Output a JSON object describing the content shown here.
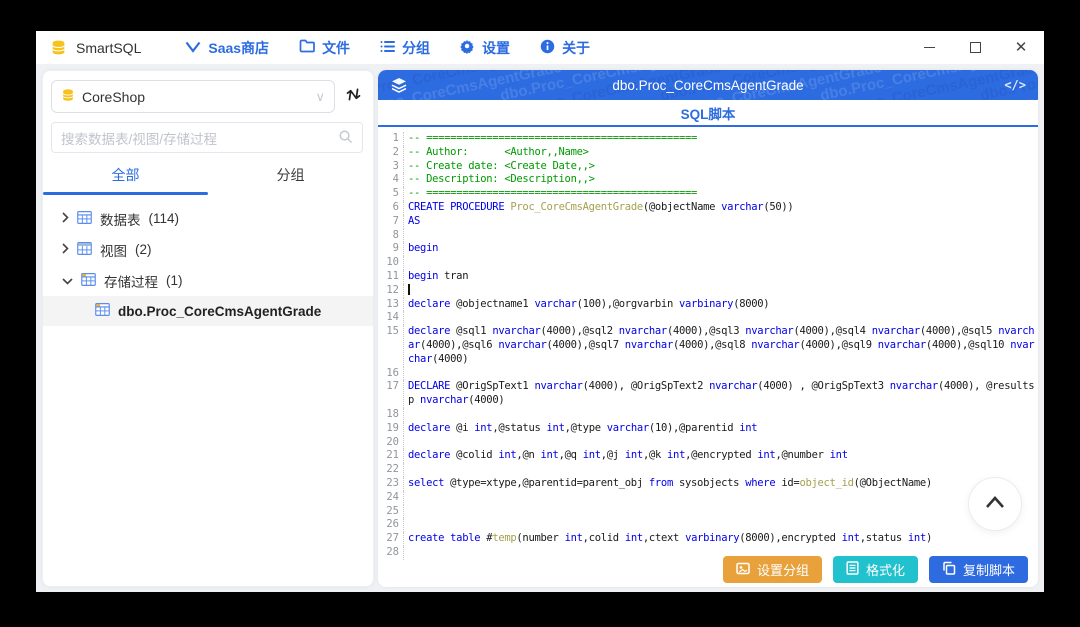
{
  "titlebar": {
    "app_name": "SmartSQL",
    "menu": [
      {
        "icon": "v-logo-icon",
        "label": "Saas商店"
      },
      {
        "icon": "folder-icon",
        "label": "文件"
      },
      {
        "icon": "list-icon",
        "label": "分组"
      },
      {
        "icon": "gear-icon",
        "label": "设置"
      },
      {
        "icon": "info-icon",
        "label": "关于"
      }
    ],
    "window_controls": [
      "minimize",
      "maximize",
      "close"
    ]
  },
  "sidebar": {
    "database_selected": "CoreShop",
    "search_placeholder": "搜索数据表/视图/存储过程",
    "tabs": [
      {
        "label": "全部"
      },
      {
        "label": "分组"
      }
    ],
    "active_tab": "全部",
    "tree": [
      {
        "label": "数据表",
        "count": "(114)",
        "expanded": false
      },
      {
        "label": "视图",
        "count": "(2)",
        "expanded": false
      },
      {
        "label": "存储过程",
        "count": "(1)",
        "expanded": true
      }
    ],
    "selected_item": "dbo.Proc_CoreCmsAgentGrade"
  },
  "main": {
    "header_title": "dbo.Proc_CoreCmsAgentGrade",
    "code_button": "</>",
    "tab_label": "SQL脚本",
    "watermark_text": "dbo.Proc_CoreCmsAgentGrade",
    "actions": [
      {
        "label": "设置分组",
        "color": "#e9a23b",
        "icon": "group-settings-icon"
      },
      {
        "label": "格式化",
        "color": "#21c1cd",
        "icon": "format-icon"
      },
      {
        "label": "复制脚本",
        "color": "#2e6be0",
        "icon": "copy-icon"
      }
    ]
  },
  "colors": {
    "accent_blue": "#2d6ce0",
    "keyword": "#0000e8",
    "comment": "#009a00",
    "identifier": "#a5a150",
    "plain": "#1a1a1a"
  },
  "code_lines": [
    {
      "n": 1,
      "tokens": [
        [
          "c",
          "-- ============================================="
        ]
      ]
    },
    {
      "n": 2,
      "tokens": [
        [
          "c",
          "-- Author:      <Author,,Name>"
        ]
      ]
    },
    {
      "n": 3,
      "tokens": [
        [
          "c",
          "-- Create date: <Create Date,,>"
        ]
      ]
    },
    {
      "n": 4,
      "tokens": [
        [
          "c",
          "-- Description: <Description,,>"
        ]
      ]
    },
    {
      "n": 5,
      "tokens": [
        [
          "c",
          "-- ============================================="
        ]
      ]
    },
    {
      "n": 6,
      "tokens": [
        [
          "k",
          "CREATE PROCEDURE"
        ],
        [
          "t",
          " "
        ],
        [
          "o",
          "Proc_CoreCmsAgentGrade"
        ],
        [
          "t",
          "(@objectName "
        ],
        [
          "k",
          "varchar"
        ],
        [
          "t",
          "(50))"
        ]
      ]
    },
    {
      "n": 7,
      "tokens": [
        [
          "k",
          "AS"
        ]
      ]
    },
    {
      "n": 8,
      "tokens": []
    },
    {
      "n": 9,
      "tokens": [
        [
          "k",
          "begin"
        ]
      ]
    },
    {
      "n": 10,
      "tokens": []
    },
    {
      "n": 11,
      "tokens": [
        [
          "k",
          "begin"
        ],
        [
          "t",
          " tran"
        ]
      ]
    },
    {
      "n": 12,
      "tokens": [
        [
          "cursor",
          ""
        ]
      ]
    },
    {
      "n": 13,
      "tokens": [
        [
          "k",
          "declare"
        ],
        [
          "t",
          " @objectname1 "
        ],
        [
          "k",
          "varchar"
        ],
        [
          "t",
          "(100),@orgvarbin "
        ],
        [
          "k",
          "varbinary"
        ],
        [
          "t",
          "(8000)"
        ]
      ]
    },
    {
      "n": 14,
      "tokens": []
    },
    {
      "n": 15,
      "tokens": [
        [
          "k",
          "declare"
        ],
        [
          "t",
          " @sql1 "
        ],
        [
          "k",
          "nvarchar"
        ],
        [
          "t",
          "(4000),@sql2 "
        ],
        [
          "k",
          "nvarchar"
        ],
        [
          "t",
          "(4000),@sql3 "
        ],
        [
          "k",
          "nvarchar"
        ],
        [
          "t",
          "(4000),@sql4 "
        ],
        [
          "k",
          "nvarchar"
        ],
        [
          "t",
          "(4000),@sql5 "
        ],
        [
          "k",
          "nvarchar"
        ],
        [
          "t",
          "(4000),@sql6 "
        ],
        [
          "k",
          "nvarchar"
        ],
        [
          "t",
          "(4000),@sql7 "
        ],
        [
          "k",
          "nvarchar"
        ],
        [
          "t",
          "(4000),@sql8 "
        ],
        [
          "k",
          "nvarchar"
        ],
        [
          "t",
          "(4000),@sql9 "
        ],
        [
          "k",
          "nvarchar"
        ],
        [
          "t",
          "(4000),@sql10 "
        ],
        [
          "k",
          "nvarchar"
        ],
        [
          "t",
          "(4000)"
        ]
      ]
    },
    {
      "n": 16,
      "tokens": []
    },
    {
      "n": 17,
      "tokens": [
        [
          "k",
          "DECLARE"
        ],
        [
          "t",
          " @OrigSpText1 "
        ],
        [
          "k",
          "nvarchar"
        ],
        [
          "t",
          "(4000), @OrigSpText2 "
        ],
        [
          "k",
          "nvarchar"
        ],
        [
          "t",
          "(4000) , @OrigSpText3 "
        ],
        [
          "k",
          "nvarchar"
        ],
        [
          "t",
          "(4000), @resultsp "
        ],
        [
          "k",
          "nvarchar"
        ],
        [
          "t",
          "(4000)"
        ]
      ]
    },
    {
      "n": 18,
      "tokens": []
    },
    {
      "n": 19,
      "tokens": [
        [
          "k",
          "declare"
        ],
        [
          "t",
          " @i "
        ],
        [
          "k",
          "int"
        ],
        [
          "t",
          ",@status "
        ],
        [
          "k",
          "int"
        ],
        [
          "t",
          ",@type "
        ],
        [
          "k",
          "varchar"
        ],
        [
          "t",
          "(10),@parentid "
        ],
        [
          "k",
          "int"
        ]
      ]
    },
    {
      "n": 20,
      "tokens": []
    },
    {
      "n": 21,
      "tokens": [
        [
          "k",
          "declare"
        ],
        [
          "t",
          " @colid "
        ],
        [
          "k",
          "int"
        ],
        [
          "t",
          ",@n "
        ],
        [
          "k",
          "int"
        ],
        [
          "t",
          ",@q "
        ],
        [
          "k",
          "int"
        ],
        [
          "t",
          ",@j "
        ],
        [
          "k",
          "int"
        ],
        [
          "t",
          ",@k "
        ],
        [
          "k",
          "int"
        ],
        [
          "t",
          ",@encrypted "
        ],
        [
          "k",
          "int"
        ],
        [
          "t",
          ",@number "
        ],
        [
          "k",
          "int"
        ]
      ]
    },
    {
      "n": 22,
      "tokens": []
    },
    {
      "n": 23,
      "tokens": [
        [
          "k",
          "select"
        ],
        [
          "t",
          " @type=xtype,@parentid=parent_obj "
        ],
        [
          "k",
          "from"
        ],
        [
          "t",
          " sysobjects "
        ],
        [
          "k",
          "where"
        ],
        [
          "t",
          " id="
        ],
        [
          "o",
          "object_id"
        ],
        [
          "t",
          "(@ObjectName)"
        ]
      ]
    },
    {
      "n": 24,
      "tokens": []
    },
    {
      "n": 25,
      "tokens": []
    },
    {
      "n": 26,
      "tokens": []
    },
    {
      "n": 27,
      "tokens": [
        [
          "k",
          "create table"
        ],
        [
          "t",
          " #"
        ],
        [
          "o",
          "temp"
        ],
        [
          "t",
          "(number "
        ],
        [
          "k",
          "int"
        ],
        [
          "t",
          ",colid "
        ],
        [
          "k",
          "int"
        ],
        [
          "t",
          ",ctext "
        ],
        [
          "k",
          "varbinary"
        ],
        [
          "t",
          "(8000),encrypted "
        ],
        [
          "k",
          "int"
        ],
        [
          "t",
          ",status "
        ],
        [
          "k",
          "int"
        ],
        [
          "t",
          ")"
        ]
      ]
    },
    {
      "n": 28,
      "tokens": []
    }
  ]
}
